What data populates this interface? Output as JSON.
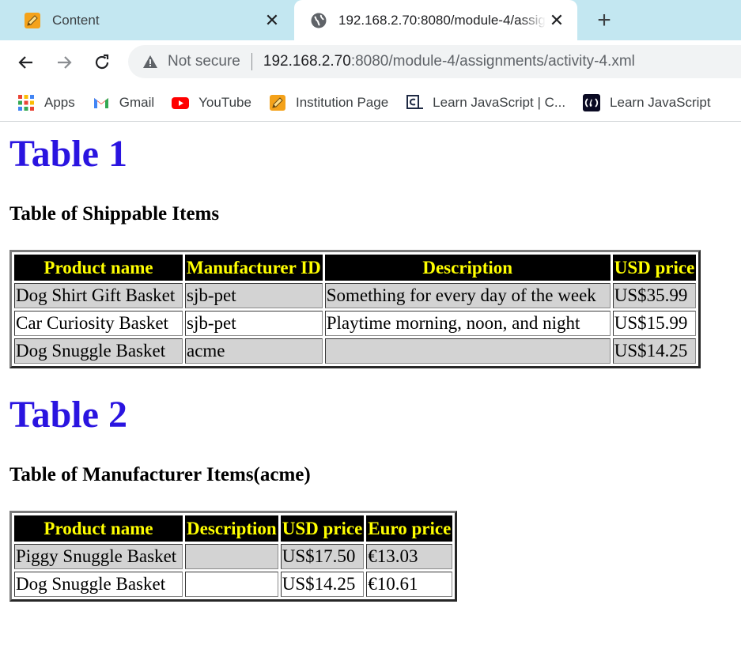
{
  "browser": {
    "tabs": [
      {
        "title": "Content",
        "active": false
      },
      {
        "title": "192.168.2.70:8080/module-4/assignments/activity-4.xml",
        "active": true
      }
    ],
    "new_tab_label": "+",
    "close_glyph": "✕",
    "security_label": "Not secure",
    "url_host": "192.168.2.70",
    "url_rest": ":8080/module-4/assignments/activity-4.xml",
    "bookmarks": [
      {
        "label": "Apps",
        "icon": "apps-grid-icon"
      },
      {
        "label": "Gmail",
        "icon": "gmail-icon"
      },
      {
        "label": "YouTube",
        "icon": "youtube-icon"
      },
      {
        "label": "Institution Page",
        "icon": "pencil-icon"
      },
      {
        "label": "Learn JavaScript | C...",
        "icon": "codecademy-icon"
      },
      {
        "label": "Learn JavaScript",
        "icon": "freecodecamp-icon"
      }
    ]
  },
  "colors": {
    "heading": "#2a14e0",
    "header_bg": "#000000",
    "header_text": "#ffff00",
    "shaded_row": "#d3d3d3"
  },
  "table1": {
    "title": "Table 1",
    "subtitle": "Table of Shippable Items",
    "headers": [
      "Product name",
      "Manufacturer ID",
      "Description",
      "USD price"
    ],
    "rows": [
      [
        "Dog Shirt Gift Basket",
        "sjb-pet",
        "Something for every day of the week",
        "US$35.99"
      ],
      [
        "Car Curiosity Basket",
        "sjb-pet",
        "Playtime morning, noon, and night",
        "US$15.99"
      ],
      [
        "Dog Snuggle Basket",
        "acme",
        "",
        "US$14.25"
      ]
    ]
  },
  "table2": {
    "title": "Table 2",
    "subtitle": "Table of Manufacturer Items(acme)",
    "headers": [
      "Product name",
      "Description",
      "USD price",
      "Euro price"
    ],
    "rows": [
      [
        "Piggy Snuggle Basket",
        "",
        "US$17.50",
        "€13.03"
      ],
      [
        "Dog Snuggle Basket",
        "",
        "US$14.25",
        "€10.61"
      ]
    ]
  }
}
